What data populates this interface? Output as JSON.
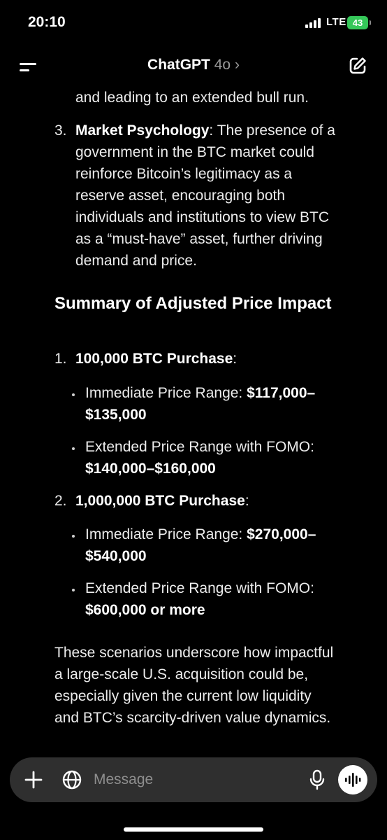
{
  "status_bar": {
    "time": "20:10",
    "network": "LTE",
    "battery": "43"
  },
  "header": {
    "title": "ChatGPT",
    "model": "4o",
    "chevron": "›"
  },
  "icons": {
    "menu": "menu-icon",
    "edit": "new-chat-icon",
    "plus": "plus-icon",
    "globe": "globe-icon",
    "mic": "microphone-icon",
    "voice": "voice-mode-icon"
  },
  "message": {
    "intro_line": "and leading to an extended bull run.",
    "point3": {
      "number": "3.",
      "title": "Market Psychology",
      "lines": [
        ": The presence of a",
        "government in the BTC market could",
        "reinforce Bitcoin’s legitimacy as a",
        "reserve asset, encouraging both",
        "individuals and institutions to view BTC",
        "as a “must-have” asset, further driving",
        "demand and price."
      ]
    },
    "summary_heading": "Summary of Adjusted Price Impact",
    "summary": [
      {
        "number": "1.",
        "title": "100,000 BTC Purchase",
        "colon": ":",
        "immediate_label": "Immediate Price Range: ",
        "immediate_value_1": "$117,000–",
        "immediate_value_2": "$135,000",
        "extended_label": "Extended Price Range with FOMO:",
        "extended_value": "$140,000–$160,000"
      },
      {
        "number": "2.",
        "title": "1,000,000 BTC Purchase",
        "colon": ":",
        "immediate_label": "Immediate Price Range: ",
        "immediate_value_1": "$270,000–",
        "immediate_value_2": "$540,000",
        "extended_label": "Extended Price Range with FOMO:",
        "extended_value": "$600,000 or more"
      }
    ],
    "conclusion_lines": [
      "These scenarios underscore how impactful",
      "a large-scale U.S. acquisition could be,",
      "especially given the current low liquidity",
      "and BTC’s scarcity-driven value dynamics."
    ]
  },
  "composer": {
    "placeholder": "Message"
  },
  "colors": {
    "background": "#000000",
    "text": "#ececec",
    "composer_bg": "#2f2f2f",
    "battery": "#35c759"
  }
}
